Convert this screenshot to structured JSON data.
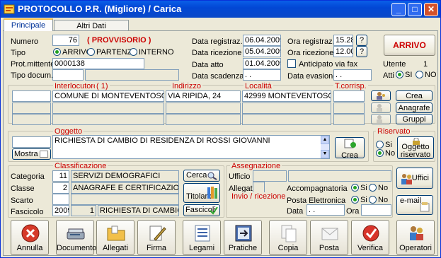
{
  "window": {
    "title": "PROTOCOLLO P.R. (Migliore) / Carica"
  },
  "tabs": [
    {
      "label": "Principale"
    },
    {
      "label": "Altri Dati"
    }
  ],
  "main": {
    "numero_label": "Numero",
    "numero_value": "76",
    "status_badge": "( PROVVISORIO )",
    "tipo_label": "Tipo",
    "tipo_options": [
      "ARRIVO",
      "PARTENZA",
      "INTERNO"
    ],
    "tipo_selected": "ARRIVO",
    "prot_mittente_label": "Prot.mittente",
    "prot_mittente_value": "0000138",
    "tipo_docum_label": "Tipo docum.",
    "data_registraz_label": "Data registraz.",
    "data_registraz_value": "06.04.2009",
    "data_ricezione_label": "Data ricezione",
    "data_ricezione_value": "05.04.2009",
    "data_atto_label": "Data atto",
    "data_atto_value": "01.04.2009",
    "data_scadenza_label": "Data scadenza",
    "data_scadenza_value": " . .",
    "ora_registraz_label": "Ora registraz.",
    "ora_registraz_value": "15.28",
    "ora_ricezione_label": "Ora ricezione",
    "ora_ricezione_value": "12.00",
    "help_label": "?",
    "anticipato_label": "Anticipato via fax",
    "data_evasione_label": "Data evasione",
    "data_evasione_value": " . .",
    "arrivo_badge": "ARRIVO",
    "utente_label": "Utente",
    "utente_value": "1",
    "atti_label": "Atti",
    "atti_options": [
      "SI",
      "NO"
    ],
    "atti_selected": "SI"
  },
  "interlocutori": {
    "header_interlocutore": "Interlocutore",
    "header_count": "( 1)",
    "header_indirizzo": "Indirizzo",
    "header_localita": "Località",
    "header_tcorrisp": "T.corrisp.",
    "row1": {
      "interlocutore": "COMUNE DI MONTEVENTOSO",
      "indirizzo": "VIA RIPIDA, 24",
      "localita": "42999 MONTEVENTOSO (MV)"
    },
    "crea_label": "Crea",
    "anagrafe_label": "Anagrafe",
    "gruppi_label": "Gruppi"
  },
  "oggetto": {
    "header": "Oggetto",
    "text": "RICHIESTA DI CAMBIO DI RESIDENZA DI ROSSI GIOVANNI",
    "mostra_label": "Mostra",
    "crea_label": "Crea"
  },
  "riservato": {
    "header": "Riservato",
    "options": [
      "Si",
      "No"
    ],
    "selected": "No",
    "button_label": "Oggetto riservato"
  },
  "classificazione": {
    "header": "Classificazione",
    "categoria_label": "Categoria",
    "categoria_code": "11",
    "categoria_desc": "SERVIZI DEMOGRAFICI",
    "classe_label": "Classe",
    "classe_code": "2",
    "classe_desc": "ANAGRAFE E CERTIFICAZIONI",
    "scarto_label": "Scarto",
    "fascicolo_label": "Fascicolo",
    "fascicolo_year": "2009",
    "fascicolo_num": "1",
    "fascicolo_desc": "RICHIESTA DI CAMBIO DI RE",
    "cerca_label": "Cerca",
    "titolario_label": "Titolario",
    "fascicoli_label": "Fascicoli"
  },
  "assegnazione": {
    "header": "Assegnazione",
    "ufficio_label": "Ufficio",
    "allegati_label": "Allegati",
    "accompagnatoria_label": "Accompagnatoria",
    "accompagnatoria_options": [
      "Si",
      "No"
    ],
    "accompagnatoria_selected": "Si",
    "invio_header": "Invio / ricezione",
    "posta_elettronica_label": "Posta Elettronica",
    "posta_elettronica_options": [
      "Si",
      "No"
    ],
    "posta_elettronica_selected": "Si",
    "data_label": "Data",
    "data_value": " . .",
    "ora_label": "Ora",
    "uffici_label": "Uffici",
    "email_label": "e-mail"
  },
  "toolbar": [
    {
      "label": "Annulla",
      "icon": "cancel-icon"
    },
    {
      "label": "Documento",
      "icon": "scanner-icon"
    },
    {
      "label": "Allegati",
      "icon": "folder-icon"
    },
    {
      "label": "Firma",
      "icon": "pen-icon"
    },
    {
      "label": "Legami",
      "icon": "links-icon"
    },
    {
      "label": "Pratiche",
      "icon": "pratiche-icon"
    },
    {
      "label": "Copia",
      "icon": "copy-icon"
    },
    {
      "label": "Posta",
      "icon": "mail-icon"
    },
    {
      "label": "Verifica",
      "icon": "verify-icon"
    },
    {
      "label": "Operatori",
      "icon": "users-icon"
    }
  ],
  "colors": {
    "title_bar": "#0a5fe8",
    "accent_red": "#cc0000",
    "panel_bg": "#ece9d8"
  }
}
